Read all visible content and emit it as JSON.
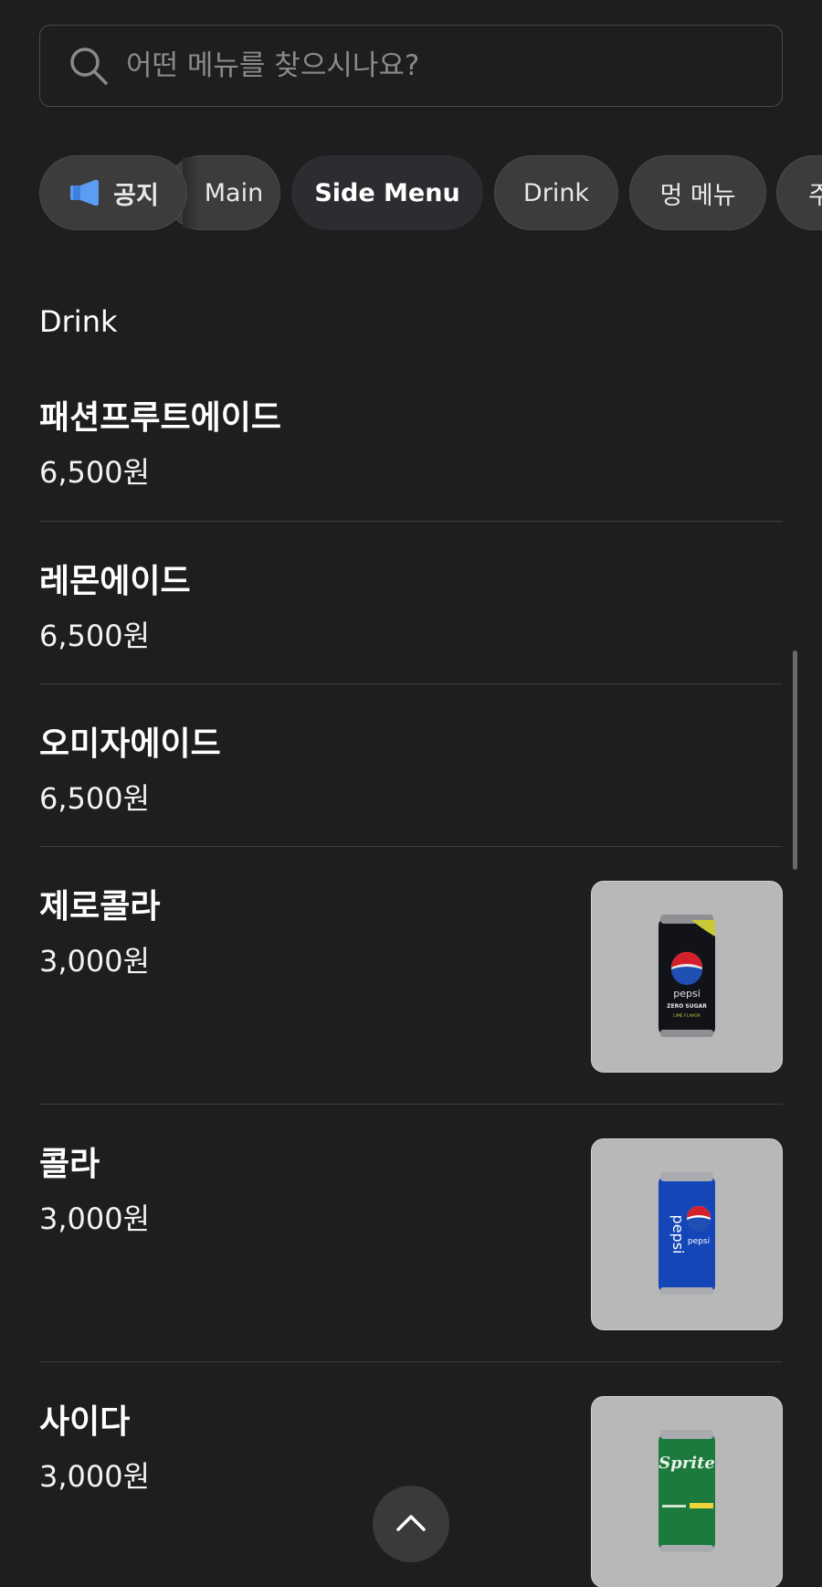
{
  "search": {
    "placeholder": "어떤 메뉴를 찾으시나요?"
  },
  "chips": {
    "notice": "공지",
    "main": "Main",
    "side_menu": "Side Menu",
    "drink": "Drink",
    "dog_menu": "멍 메뉴",
    "partial": "주"
  },
  "section": {
    "title": "Drink"
  },
  "items": [
    {
      "name": "패션프루트에이드",
      "price": "6,500원"
    },
    {
      "name": "레몬에이드",
      "price": "6,500원"
    },
    {
      "name": "오미자에이드",
      "price": "6,500원"
    },
    {
      "name": "제로콜라",
      "price": "3,000원",
      "image": "pepsi-zero-can",
      "can_label": "pepsi",
      "can_sub": "ZERO SUGAR",
      "can_sub2": "LIME FLAVOR"
    },
    {
      "name": "콜라",
      "price": "3,000원",
      "image": "pepsi-can",
      "can_label": "pepsi",
      "can_label2": "pepsi"
    },
    {
      "name": "사이다",
      "price": "3,000원",
      "image": "sprite-can",
      "can_label": "Sprite"
    }
  ],
  "colors": {
    "background": "#1e1e1e",
    "chip": "#3c3c3c",
    "chip_active": "#2b2d31",
    "divider": "#3d3d3d",
    "thumb_bg": "#b8b8b8",
    "megaphone": "#5b9cf5"
  },
  "icons": {
    "search": "search-icon",
    "notice": "megaphone-icon",
    "to_top": "chevron-up-icon"
  }
}
